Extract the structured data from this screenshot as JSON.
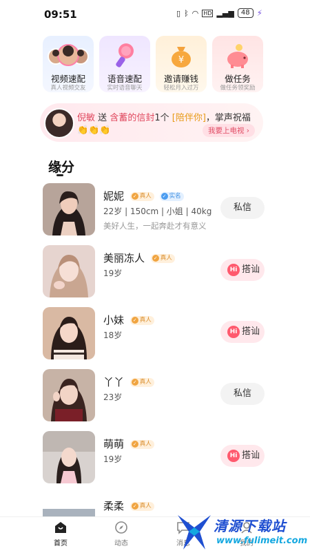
{
  "status_bar": {
    "time": "09:51",
    "battery": "48"
  },
  "quick_actions": [
    {
      "title": "视频速配",
      "subtitle": "真人视频交友",
      "icon": "avatars-icon"
    },
    {
      "title": "语音速配",
      "subtitle": "实时语音聊天",
      "icon": "microphone-icon"
    },
    {
      "title": "邀请赚钱",
      "subtitle": "轻松月入过万",
      "icon": "money-bag-icon"
    },
    {
      "title": "做任务",
      "subtitle": "做任务领奖励",
      "icon": "piggy-bank-icon"
    }
  ],
  "broadcast": {
    "sender": "倪敏",
    "send_word": "送",
    "receiver": "含蓄的信封",
    "count": "1个",
    "gift_tag": "[陪伴你]",
    "suffix": "，掌声祝福",
    "claps": "👏👏👏",
    "button": "我要上电视 ›"
  },
  "section": {
    "title": "缘分"
  },
  "badges": {
    "real": "真人",
    "auth": "实名"
  },
  "people": [
    {
      "name": "妮妮",
      "auth": true,
      "info": "22岁 | 150cm | 小姐 | 40kg",
      "motto": "美好人生，一起奔赴才有意义",
      "action": "私信",
      "action_type": "message"
    },
    {
      "name": "美丽冻人",
      "auth": false,
      "info": "19岁",
      "motto": "",
      "action": "搭讪",
      "action_type": "greet"
    },
    {
      "name": "小妹",
      "auth": false,
      "info": "18岁",
      "motto": "",
      "action": "搭讪",
      "action_type": "greet"
    },
    {
      "name": "丫丫",
      "auth": false,
      "info": "23岁",
      "motto": "",
      "action": "私信",
      "action_type": "message"
    },
    {
      "name": "萌萌",
      "auth": false,
      "info": "19岁",
      "motto": "",
      "action": "搭讪",
      "action_type": "greet"
    },
    {
      "name": "柔柔",
      "auth": false,
      "info": "",
      "motto": "",
      "action": "",
      "action_type": ""
    }
  ],
  "tabs": [
    {
      "label": "首页",
      "icon": "home-icon",
      "active": true
    },
    {
      "label": "动态",
      "icon": "compass-icon",
      "active": false
    },
    {
      "label": "消息",
      "icon": "chat-icon",
      "active": false
    },
    {
      "label": "我的",
      "icon": "profile-icon",
      "active": false
    }
  ],
  "watermark": {
    "text": "清源下载站",
    "url": "www.fulimeit.com"
  },
  "colors": {
    "accent": "#e0485e",
    "greet_bg": "#ffe8ec",
    "gold": "#e79a16"
  }
}
